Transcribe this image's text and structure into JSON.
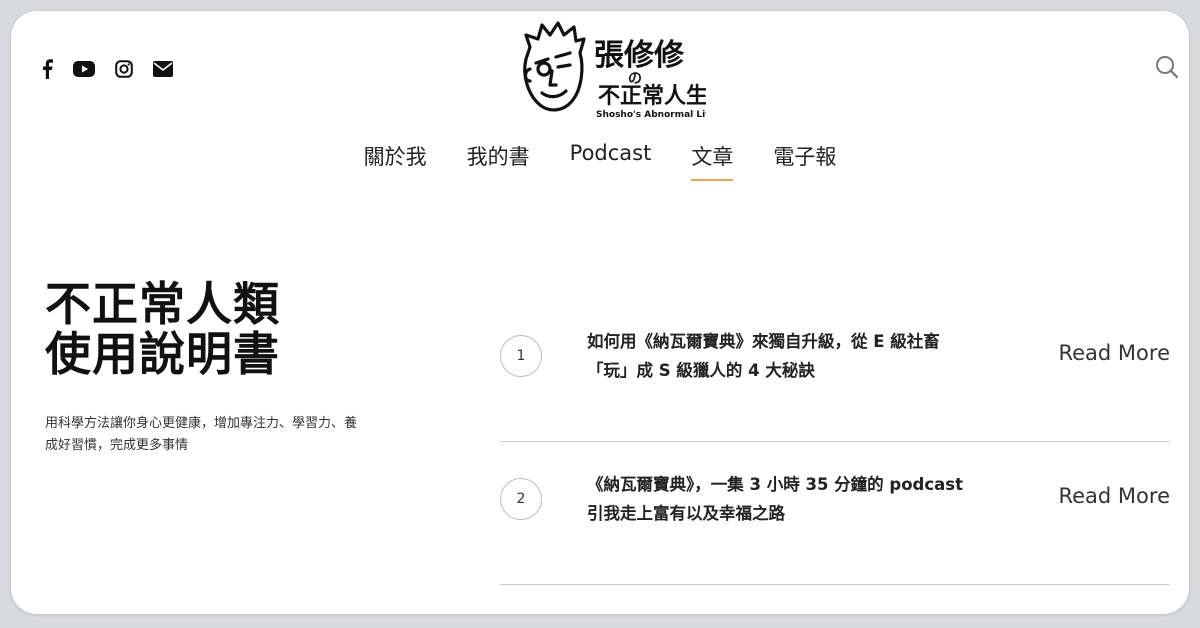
{
  "logo": {
    "text_line1": "張修修",
    "text_no": "の",
    "text_line2": "不正常人生",
    "subtitle": "Shosho's Abnormal Life"
  },
  "social_icons": [
    "facebook-icon",
    "youtube-icon",
    "instagram-icon",
    "email-icon"
  ],
  "nav": {
    "items": [
      {
        "label": "關於我"
      },
      {
        "label": "我的書"
      },
      {
        "label": "Podcast"
      },
      {
        "label": "文章"
      },
      {
        "label": "電子報"
      }
    ],
    "active": "文章",
    "accent_color": "#e9a157"
  },
  "hero": {
    "title_line1": "不正常人類",
    "title_line2": "使用說明書",
    "description": "用科學方法讓你身心更健康，增加專注力、學習力、養成好習慣，完成更多事情"
  },
  "articles": [
    {
      "number": "1",
      "title_line1": "如何用《納瓦爾寶典》來獨自升級，從 E 級社畜",
      "title_line2": "「玩」成 S 級獵人的 4 大秘訣",
      "cta": "Read More"
    },
    {
      "number": "2",
      "title_line1": "《納瓦爾寶典》，一集 3 小時 35 分鐘的 podcast",
      "title_line2": "引我走上富有以及幸福之路",
      "cta": "Read More"
    }
  ]
}
